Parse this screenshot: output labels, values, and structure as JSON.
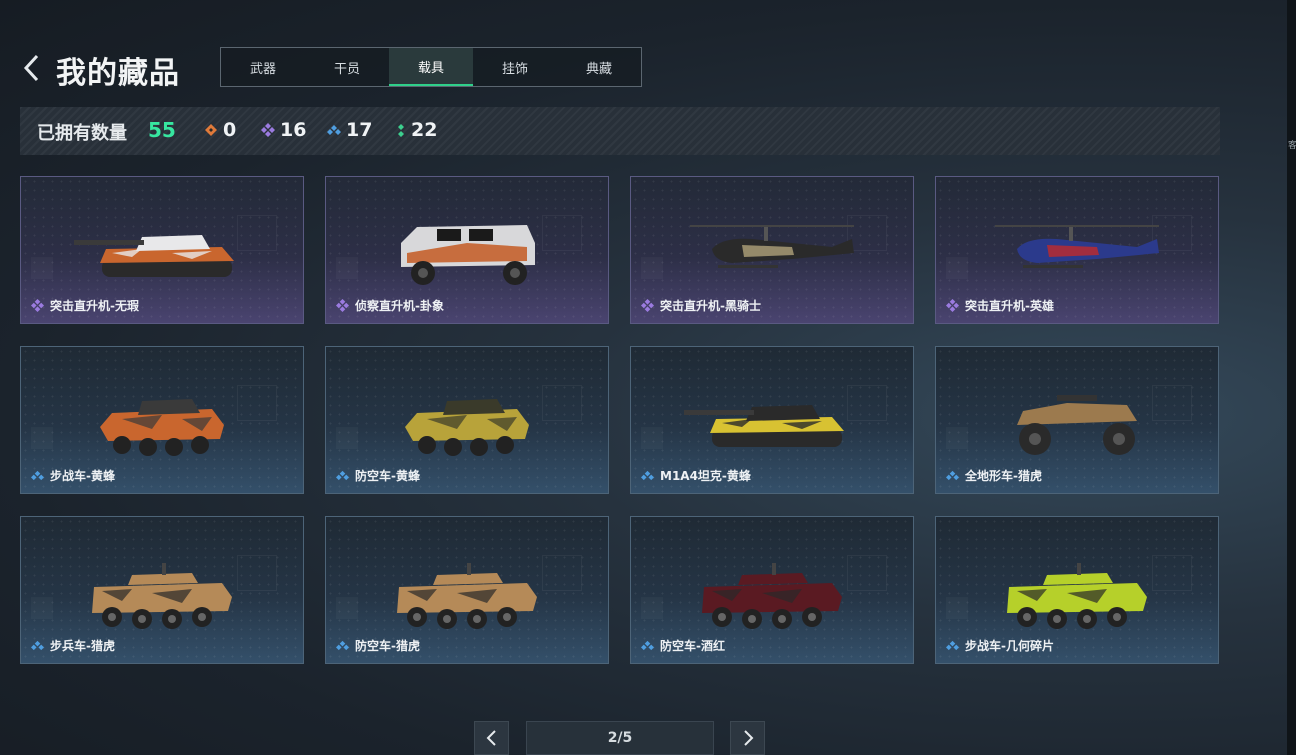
{
  "header": {
    "title": "我的藏品",
    "tabs": [
      {
        "label": "武器",
        "active": false
      },
      {
        "label": "干员",
        "active": false
      },
      {
        "label": "载具",
        "active": true
      },
      {
        "label": "挂饰",
        "active": false
      },
      {
        "label": "典藏",
        "active": false
      }
    ]
  },
  "stats": {
    "owned_label": "已拥有数量",
    "owned_total": "55",
    "rarities": [
      {
        "icon": "orange-diamond-icon",
        "color": "#e07a3a",
        "value": "0"
      },
      {
        "icon": "purple-diamond-icon",
        "color": "#9b7be0",
        "value": "16"
      },
      {
        "icon": "blue-diamond-icon",
        "color": "#4f9ee0",
        "value": "17"
      },
      {
        "icon": "green-dots-icon",
        "color": "#3ccf8e",
        "value": "22"
      }
    ]
  },
  "items": [
    {
      "name": "突击直升机-无瑕",
      "rarity": "purple",
      "vehicle": "tank",
      "colors": [
        "#c9662e",
        "#e8e8ea"
      ]
    },
    {
      "name": "侦察直升机-卦象",
      "rarity": "purple",
      "vehicle": "truck",
      "colors": [
        "#d8d8da",
        "#c45a22"
      ]
    },
    {
      "name": "突击直升机-黑骑士",
      "rarity": "purple",
      "vehicle": "heli",
      "colors": [
        "#2a2a2a",
        "#b0a27a"
      ]
    },
    {
      "name": "突击直升机-英雄",
      "rarity": "purple",
      "vehicle": "heli",
      "colors": [
        "#2b3a8c",
        "#c02a2a"
      ]
    },
    {
      "name": "步战车-黄蜂",
      "rarity": "blue",
      "vehicle": "ifv",
      "colors": [
        "#c9662e",
        "#3a3a3a"
      ]
    },
    {
      "name": "防空车-黄蜂",
      "rarity": "blue",
      "vehicle": "ifv",
      "colors": [
        "#b8a33a",
        "#3a3a2a"
      ]
    },
    {
      "name": "M1A4坦克-黄蜂",
      "rarity": "blue",
      "vehicle": "tank",
      "colors": [
        "#d8c232",
        "#2a2a2a"
      ]
    },
    {
      "name": "全地形车-猎虎",
      "rarity": "blue",
      "vehicle": "atv",
      "colors": [
        "#9c7a4e",
        "#2a2a2a"
      ]
    },
    {
      "name": "步兵车-猎虎",
      "rarity": "blue",
      "vehicle": "apc",
      "colors": [
        "#b58a58",
        "#2a2a2a"
      ]
    },
    {
      "name": "防空车-猎虎",
      "rarity": "blue",
      "vehicle": "apc",
      "colors": [
        "#b58a58",
        "#2a2a2a"
      ]
    },
    {
      "name": "防空车-酒红",
      "rarity": "blue",
      "vehicle": "apc",
      "colors": [
        "#5a1a22",
        "#2a2a2a"
      ]
    },
    {
      "name": "步战车-几何碎片",
      "rarity": "blue",
      "vehicle": "apc",
      "colors": [
        "#b6d02a",
        "#2a2a2a"
      ]
    }
  ],
  "pager": {
    "text": "2/5"
  }
}
